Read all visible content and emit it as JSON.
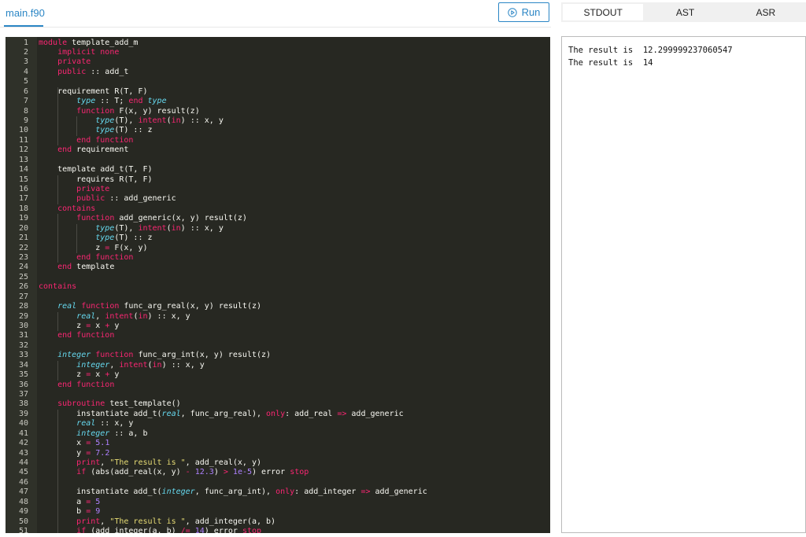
{
  "file_tab": {
    "label": "main.f90"
  },
  "run_button": {
    "label": "Run",
    "icon": "play-circle-icon"
  },
  "output_tabs": [
    {
      "label": "STDOUT",
      "active": true
    },
    {
      "label": "AST",
      "active": false
    },
    {
      "label": "ASR",
      "active": false
    }
  ],
  "colors": {
    "accent": "#2b86c5",
    "editor_bg": "#272822",
    "keyword": "#f92672",
    "type": "#66d9ef",
    "number": "#ae81ff",
    "string": "#e6db74",
    "text": "#f8f8f2"
  },
  "editor": {
    "lines": [
      [
        [
          "kw",
          "module"
        ],
        [
          "t",
          " template_add_m"
        ]
      ],
      [
        [
          "t",
          "    "
        ],
        [
          "kw",
          "implicit none"
        ]
      ],
      [
        [
          "t",
          "    "
        ],
        [
          "kw",
          "private"
        ]
      ],
      [
        [
          "t",
          "    "
        ],
        [
          "kw",
          "public"
        ],
        [
          "t",
          " :: add_t"
        ]
      ],
      [],
      [
        [
          "t",
          "    requirement R(T, F)"
        ]
      ],
      [
        [
          "t",
          "        "
        ],
        [
          "ty",
          "type"
        ],
        [
          "t",
          " :: T; "
        ],
        [
          "kw",
          "end"
        ],
        [
          "t",
          " "
        ],
        [
          "ty",
          "type"
        ]
      ],
      [
        [
          "t",
          "        "
        ],
        [
          "kw",
          "function"
        ],
        [
          "t",
          " F(x, y) result(z)"
        ]
      ],
      [
        [
          "t",
          "            "
        ],
        [
          "ty",
          "type"
        ],
        [
          "t",
          "(T), "
        ],
        [
          "kw",
          "intent"
        ],
        [
          "t",
          "("
        ],
        [
          "kw",
          "in"
        ],
        [
          "t",
          ") :: x, y"
        ]
      ],
      [
        [
          "t",
          "            "
        ],
        [
          "ty",
          "type"
        ],
        [
          "t",
          "(T) :: z"
        ]
      ],
      [
        [
          "t",
          "        "
        ],
        [
          "kw",
          "end function"
        ]
      ],
      [
        [
          "t",
          "    "
        ],
        [
          "kw",
          "end"
        ],
        [
          "t",
          " requirement"
        ]
      ],
      [],
      [
        [
          "t",
          "    template add_t(T, F)"
        ]
      ],
      [
        [
          "t",
          "        requires R(T, F)"
        ]
      ],
      [
        [
          "t",
          "        "
        ],
        [
          "kw",
          "private"
        ]
      ],
      [
        [
          "t",
          "        "
        ],
        [
          "kw",
          "public"
        ],
        [
          "t",
          " :: add_generic"
        ]
      ],
      [
        [
          "t",
          "    "
        ],
        [
          "kw",
          "contains"
        ]
      ],
      [
        [
          "t",
          "        "
        ],
        [
          "kw",
          "function"
        ],
        [
          "t",
          " add_generic(x, y) result(z)"
        ]
      ],
      [
        [
          "t",
          "            "
        ],
        [
          "ty",
          "type"
        ],
        [
          "t",
          "(T), "
        ],
        [
          "kw",
          "intent"
        ],
        [
          "t",
          "("
        ],
        [
          "kw",
          "in"
        ],
        [
          "t",
          ") :: x, y"
        ]
      ],
      [
        [
          "t",
          "            "
        ],
        [
          "ty",
          "type"
        ],
        [
          "t",
          "(T) :: z"
        ]
      ],
      [
        [
          "t",
          "            z "
        ],
        [
          "kw",
          "="
        ],
        [
          "t",
          " F(x, y)"
        ]
      ],
      [
        [
          "t",
          "        "
        ],
        [
          "kw",
          "end function"
        ]
      ],
      [
        [
          "t",
          "    "
        ],
        [
          "kw",
          "end"
        ],
        [
          "t",
          " template"
        ]
      ],
      [],
      [
        [
          "kw",
          "contains"
        ]
      ],
      [],
      [
        [
          "t",
          "    "
        ],
        [
          "ty",
          "real"
        ],
        [
          "t",
          " "
        ],
        [
          "kw",
          "function"
        ],
        [
          "t",
          " func_arg_real(x, y) result(z)"
        ]
      ],
      [
        [
          "t",
          "        "
        ],
        [
          "ty",
          "real"
        ],
        [
          "t",
          ", "
        ],
        [
          "kw",
          "intent"
        ],
        [
          "t",
          "("
        ],
        [
          "kw",
          "in"
        ],
        [
          "t",
          ") :: x, y"
        ]
      ],
      [
        [
          "t",
          "        z "
        ],
        [
          "kw",
          "="
        ],
        [
          "t",
          " x "
        ],
        [
          "kw",
          "+"
        ],
        [
          "t",
          " y"
        ]
      ],
      [
        [
          "t",
          "    "
        ],
        [
          "kw",
          "end function"
        ]
      ],
      [],
      [
        [
          "t",
          "    "
        ],
        [
          "ty",
          "integer"
        ],
        [
          "t",
          " "
        ],
        [
          "kw",
          "function"
        ],
        [
          "t",
          " func_arg_int(x, y) result(z)"
        ]
      ],
      [
        [
          "t",
          "        "
        ],
        [
          "ty",
          "integer"
        ],
        [
          "t",
          ", "
        ],
        [
          "kw",
          "intent"
        ],
        [
          "t",
          "("
        ],
        [
          "kw",
          "in"
        ],
        [
          "t",
          ") :: x, y"
        ]
      ],
      [
        [
          "t",
          "        z "
        ],
        [
          "kw",
          "="
        ],
        [
          "t",
          " x "
        ],
        [
          "kw",
          "+"
        ],
        [
          "t",
          " y"
        ]
      ],
      [
        [
          "t",
          "    "
        ],
        [
          "kw",
          "end function"
        ]
      ],
      [],
      [
        [
          "t",
          "    "
        ],
        [
          "kw",
          "subroutine"
        ],
        [
          "t",
          " test_template()"
        ]
      ],
      [
        [
          "t",
          "        instantiate add_t("
        ],
        [
          "ty",
          "real"
        ],
        [
          "t",
          ", func_arg_real), "
        ],
        [
          "kw",
          "only"
        ],
        [
          "t",
          ": add_real "
        ],
        [
          "kw",
          "=>"
        ],
        [
          "t",
          " add_generic"
        ]
      ],
      [
        [
          "t",
          "        "
        ],
        [
          "ty",
          "real"
        ],
        [
          "t",
          " :: x, y"
        ]
      ],
      [
        [
          "t",
          "        "
        ],
        [
          "ty",
          "integer"
        ],
        [
          "t",
          " :: a, b"
        ]
      ],
      [
        [
          "t",
          "        x "
        ],
        [
          "kw",
          "="
        ],
        [
          "t",
          " "
        ],
        [
          "num",
          "5.1"
        ]
      ],
      [
        [
          "t",
          "        y "
        ],
        [
          "kw",
          "="
        ],
        [
          "t",
          " "
        ],
        [
          "num",
          "7.2"
        ]
      ],
      [
        [
          "t",
          "        "
        ],
        [
          "kw",
          "print"
        ],
        [
          "t",
          ", "
        ],
        [
          "str",
          "\"The result is \""
        ],
        [
          "t",
          ", add_real(x, y)"
        ]
      ],
      [
        [
          "t",
          "        "
        ],
        [
          "kw",
          "if"
        ],
        [
          "t",
          " (abs(add_real(x, y) "
        ],
        [
          "kw",
          "-"
        ],
        [
          "t",
          " "
        ],
        [
          "num",
          "12.3"
        ],
        [
          "t",
          ") "
        ],
        [
          "kw",
          ">"
        ],
        [
          "t",
          " "
        ],
        [
          "num",
          "1e-5"
        ],
        [
          "t",
          ") error "
        ],
        [
          "kw",
          "stop"
        ]
      ],
      [],
      [
        [
          "t",
          "        instantiate add_t("
        ],
        [
          "ty",
          "integer"
        ],
        [
          "t",
          ", func_arg_int), "
        ],
        [
          "kw",
          "only"
        ],
        [
          "t",
          ": add_integer "
        ],
        [
          "kw",
          "=>"
        ],
        [
          "t",
          " add_generic"
        ]
      ],
      [
        [
          "t",
          "        a "
        ],
        [
          "kw",
          "="
        ],
        [
          "t",
          " "
        ],
        [
          "num",
          "5"
        ]
      ],
      [
        [
          "t",
          "        b "
        ],
        [
          "kw",
          "="
        ],
        [
          "t",
          " "
        ],
        [
          "num",
          "9"
        ]
      ],
      [
        [
          "t",
          "        "
        ],
        [
          "kw",
          "print"
        ],
        [
          "t",
          ", "
        ],
        [
          "str",
          "\"The result is \""
        ],
        [
          "t",
          ", add_integer(a, b)"
        ]
      ],
      [
        [
          "t",
          "        "
        ],
        [
          "kw",
          "if"
        ],
        [
          "t",
          " (add_integer(a, b) "
        ],
        [
          "kw",
          "/="
        ],
        [
          "t",
          " "
        ],
        [
          "num",
          "14"
        ],
        [
          "t",
          ") error "
        ],
        [
          "kw",
          "stop"
        ]
      ]
    ]
  },
  "stdout": [
    "The result is  12.299999237060547",
    "The result is  14"
  ]
}
